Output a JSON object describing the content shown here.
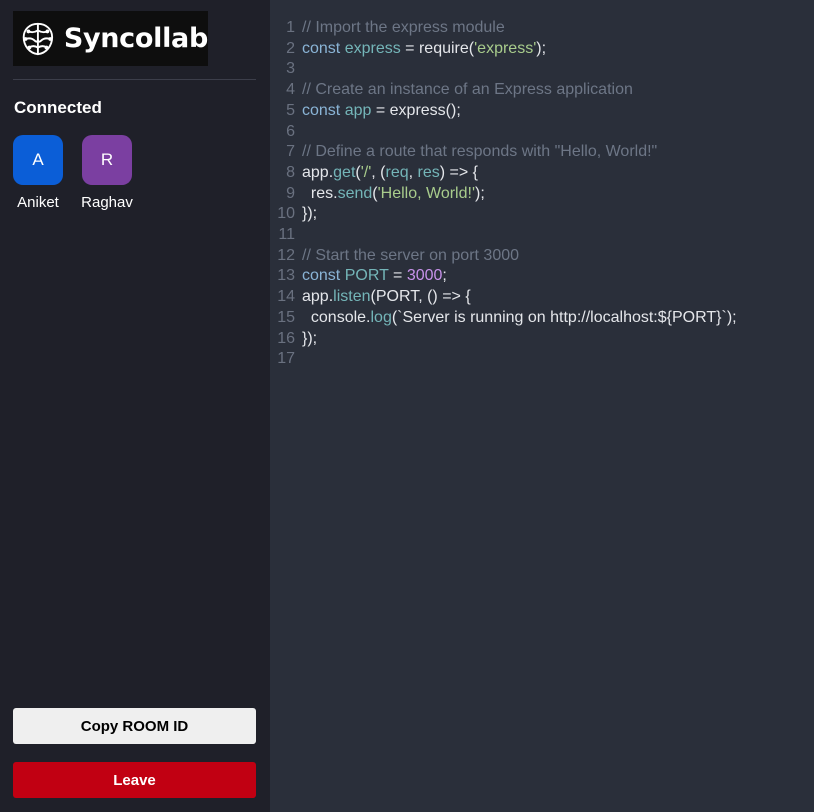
{
  "app": {
    "name": "Syncollab"
  },
  "sidebar": {
    "connected_title": "Connected",
    "users": [
      {
        "initial": "A",
        "name": "Aniket",
        "color": "#0b5ed7"
      },
      {
        "initial": "R",
        "name": "Raghav",
        "color": "#7b3fa1"
      }
    ],
    "copy_button": "Copy ROOM ID",
    "leave_button": "Leave"
  },
  "colors": {
    "sidebar_bg": "#1f2029",
    "editor_bg": "#2a2f3a",
    "leave": "#c10012",
    "copy": "#efefef"
  },
  "editor": {
    "lines": [
      {
        "num": "1",
        "tokens": [
          {
            "t": "// Import the express module",
            "c": "cm"
          }
        ]
      },
      {
        "num": "2",
        "tokens": [
          {
            "t": "const",
            "c": "kw"
          },
          {
            "t": " "
          },
          {
            "t": "express",
            "c": "fn"
          },
          {
            "t": " = require("
          },
          {
            "t": "'express'",
            "c": "str"
          },
          {
            "t": ");"
          }
        ]
      },
      {
        "num": "3",
        "tokens": []
      },
      {
        "num": "4",
        "tokens": [
          {
            "t": "// Create an instance of an Express application",
            "c": "cm"
          }
        ]
      },
      {
        "num": "5",
        "tokens": [
          {
            "t": "const",
            "c": "kw"
          },
          {
            "t": " "
          },
          {
            "t": "app",
            "c": "fn"
          },
          {
            "t": " = express();"
          }
        ]
      },
      {
        "num": "6",
        "tokens": []
      },
      {
        "num": "7",
        "tokens": [
          {
            "t": "// Define a route that responds with \"Hello, World!\"",
            "c": "cm"
          }
        ]
      },
      {
        "num": "8",
        "tokens": [
          {
            "t": "app."
          },
          {
            "t": "get",
            "c": "fn"
          },
          {
            "t": "("
          },
          {
            "t": "'/'",
            "c": "str"
          },
          {
            "t": ", ("
          },
          {
            "t": "req",
            "c": "fn"
          },
          {
            "t": ", "
          },
          {
            "t": "res",
            "c": "fn"
          },
          {
            "t": ") => {"
          }
        ]
      },
      {
        "num": "9",
        "tokens": [
          {
            "t": "  res."
          },
          {
            "t": "send",
            "c": "fn"
          },
          {
            "t": "("
          },
          {
            "t": "'Hello, World!'",
            "c": "str"
          },
          {
            "t": ");"
          }
        ]
      },
      {
        "num": "10",
        "tokens": [
          {
            "t": "});"
          }
        ]
      },
      {
        "num": "11",
        "tokens": []
      },
      {
        "num": "12",
        "tokens": [
          {
            "t": "// Start the server on port 3000",
            "c": "cm"
          }
        ]
      },
      {
        "num": "13",
        "tokens": [
          {
            "t": "const",
            "c": "kw"
          },
          {
            "t": " "
          },
          {
            "t": "PORT",
            "c": "fn"
          },
          {
            "t": " = "
          },
          {
            "t": "3000",
            "c": "num"
          },
          {
            "t": ";"
          }
        ]
      },
      {
        "num": "14",
        "tokens": [
          {
            "t": "app."
          },
          {
            "t": "listen",
            "c": "fn"
          },
          {
            "t": "(PORT, () => {"
          }
        ]
      },
      {
        "num": "15",
        "tokens": [
          {
            "t": "  console."
          },
          {
            "t": "log",
            "c": "fn"
          },
          {
            "t": "(`Server is running on http://localhost:${PORT}`);"
          }
        ]
      },
      {
        "num": "16",
        "tokens": [
          {
            "t": "});"
          }
        ]
      },
      {
        "num": "17",
        "tokens": []
      }
    ]
  }
}
